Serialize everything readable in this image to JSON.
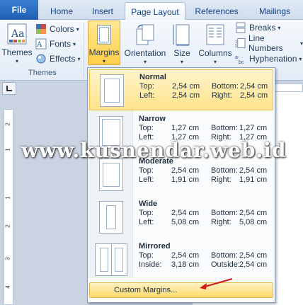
{
  "tabs": {
    "file": "File",
    "home": "Home",
    "insert": "Insert",
    "page_layout": "Page Layout",
    "references": "References",
    "mailings": "Mailings"
  },
  "ribbon": {
    "themes": {
      "themes_label": "Themes",
      "colors_label": "Colors",
      "fonts_label": "Fonts",
      "effects_label": "Effects",
      "group_label": "Themes"
    },
    "margins_label": "Margins",
    "orientation_label": "Orientation",
    "size_label": "Size",
    "columns_label": "Columns",
    "breaks_label": "Breaks",
    "line_numbers_label": "Line Numbers",
    "hyphenation_label": "Hyphenation",
    "dropdown_caret": "▾"
  },
  "margins_menu": {
    "items": [
      {
        "name": "Normal",
        "row1": {
          "l1": "Top:",
          "v1": "2,54 cm",
          "l2": "Bottom:",
          "v2": "2,54 cm"
        },
        "row2": {
          "l1": "Left:",
          "v1": "2,54 cm",
          "l2": "Right:",
          "v2": "2,54 cm"
        }
      },
      {
        "name": "Narrow",
        "row1": {
          "l1": "Top:",
          "v1": "1,27 cm",
          "l2": "Bottom:",
          "v2": "1,27 cm"
        },
        "row2": {
          "l1": "Left:",
          "v1": "1,27 cm",
          "l2": "Right:",
          "v2": "1,27 cm"
        }
      },
      {
        "name": "Moderate",
        "row1": {
          "l1": "Top:",
          "v1": "2,54 cm",
          "l2": "Bottom:",
          "v2": "2,54 cm"
        },
        "row2": {
          "l1": "Left:",
          "v1": "1,91 cm",
          "l2": "Right:",
          "v2": "1,91 cm"
        }
      },
      {
        "name": "Wide",
        "row1": {
          "l1": "Top:",
          "v1": "2,54 cm",
          "l2": "Bottom:",
          "v2": "2,54 cm"
        },
        "row2": {
          "l1": "Left:",
          "v1": "5,08 cm",
          "l2": "Right:",
          "v2": "5,08 cm"
        }
      },
      {
        "name": "Mirrored",
        "row1": {
          "l1": "Top:",
          "v1": "2,54 cm",
          "l2": "Bottom:",
          "v2": "2,54 cm"
        },
        "row2": {
          "l1": "Inside:",
          "v1": "3,18 cm",
          "l2": "Outside:",
          "v2": "2,54 cm"
        }
      }
    ],
    "custom_label": "Custom Margins..."
  },
  "ruler": {
    "numbers": [
      "2",
      "1",
      "1",
      "2",
      "3",
      "4"
    ]
  },
  "watermark": "www.kusnendar.web.id",
  "colors": {
    "accent": "#ffd04a",
    "arrow": "#d01818",
    "file_tab": "#2a6ac4"
  }
}
